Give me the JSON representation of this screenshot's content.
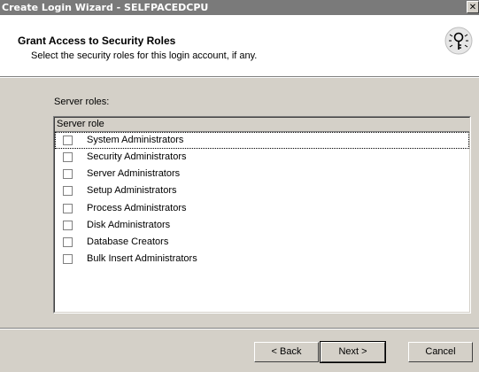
{
  "window": {
    "title": "Create Login Wizard - SELFPACEDCPU",
    "close_glyph": "✕"
  },
  "header": {
    "title": "Grant Access to Security Roles",
    "subtitle": "Select the security roles for this login account, if any.",
    "icon": "wizard-key-icon"
  },
  "roles": {
    "label": "Server roles:",
    "column_header": "Server role",
    "items": [
      {
        "label": "System Administrators",
        "checked": false,
        "focused": true
      },
      {
        "label": "Security Administrators",
        "checked": false
      },
      {
        "label": "Server Administrators",
        "checked": false
      },
      {
        "label": "Setup Administrators",
        "checked": false
      },
      {
        "label": "Process Administrators",
        "checked": false
      },
      {
        "label": "Disk Administrators",
        "checked": false
      },
      {
        "label": "Database Creators",
        "checked": false
      },
      {
        "label": "Bulk Insert Administrators",
        "checked": false
      }
    ]
  },
  "buttons": {
    "back": "< Back",
    "next": "Next >",
    "cancel": "Cancel"
  }
}
